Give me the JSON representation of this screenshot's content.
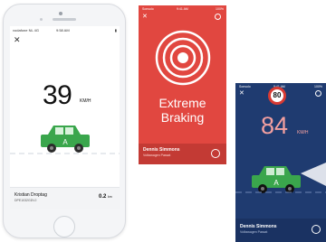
{
  "phone_speed": {
    "status": {
      "carrier": "vodafone NL 4G",
      "time": "9:58 AM",
      "battery": "▮"
    },
    "speed_value": "39",
    "speed_unit": "KM/H",
    "car_label": "A",
    "footer": {
      "driver_name": "Kristian Droptag",
      "plate": "DPE1032GDVJ",
      "distance": "0.2",
      "distance_unit": "km"
    }
  },
  "phone_braking": {
    "status": {
      "carrier": "Sonsolo",
      "time": "9:41 AM",
      "battery": "100%"
    },
    "title_line1": "Extreme",
    "title_line2": "Braking",
    "footer": {
      "driver_name": "Dennis Simmons",
      "car_model": "Volkswagen Passat"
    }
  },
  "phone_speeding": {
    "status": {
      "carrier": "Sonsolo",
      "time": "9:41 AM",
      "battery": "100%"
    },
    "speed_limit": "80",
    "speed_value": "84",
    "speed_unit": "KM/H",
    "car_label": "A",
    "footer": {
      "driver_name": "Dennis Simmons",
      "car_model": "Volkswagen Passat"
    }
  },
  "colors": {
    "braking_red": "#e14740",
    "night_blue": "#1f3b70",
    "car_green": "#3aa64c",
    "limit_red": "#d83a33"
  }
}
